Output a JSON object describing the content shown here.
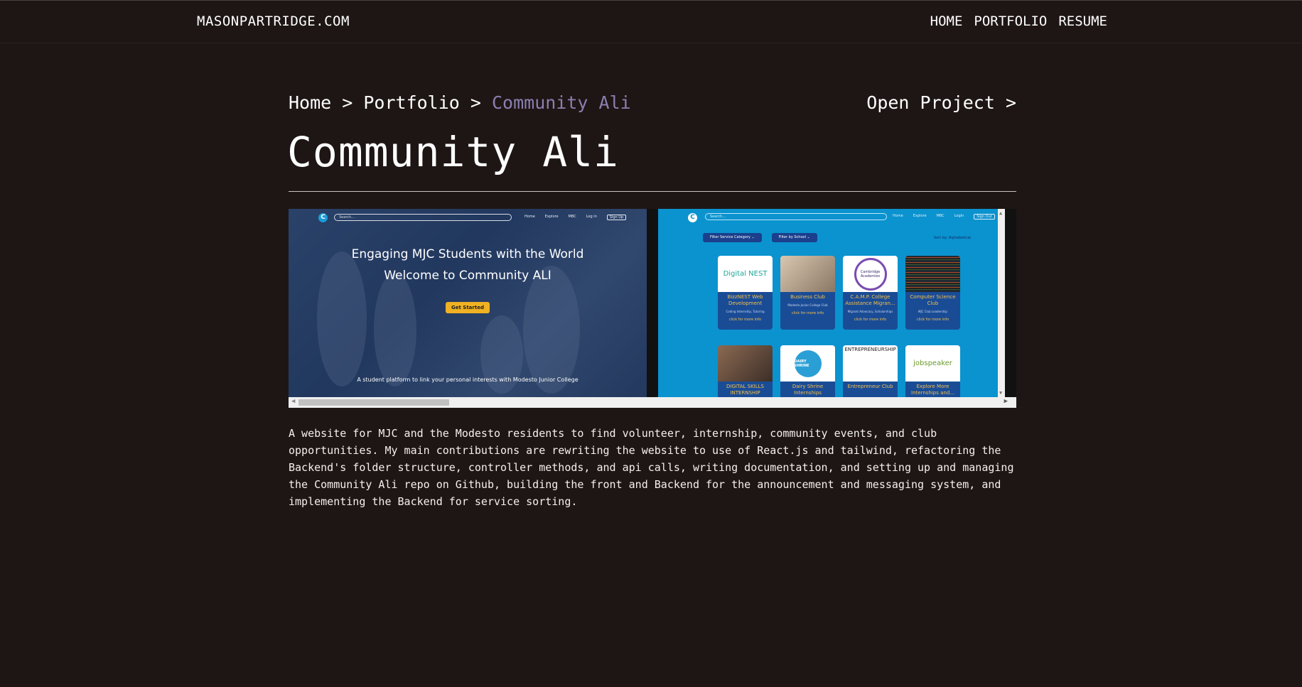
{
  "header": {
    "brand": "MASONPARTRIDGE.COM",
    "nav": [
      "HOME",
      "PORTFOLIO",
      "RESUME"
    ]
  },
  "breadcrumb": {
    "home": "Home",
    "portfolio": "Portfolio",
    "current": "Community Ali",
    "separator": " > "
  },
  "open_project": "Open Project >",
  "page_title": "Community Ali",
  "gallery": {
    "shot1": {
      "search_placeholder": "Search...",
      "links": [
        "Home",
        "Explore",
        "MBC",
        "Log in",
        "Sign Up"
      ],
      "headline1": "Engaging MJC Students with the World",
      "headline2": "Welcome to Community ALI",
      "cta": "Get Started",
      "tagline": "A student platform to link your personal interests with Modesto Junior College"
    },
    "shot2": {
      "search_placeholder": "Search...",
      "links": [
        "Home",
        "Explore",
        "MBC",
        "Login",
        "Sign Out"
      ],
      "filters": [
        "Filter Service Category ⌄",
        "Filter by School ⌄"
      ],
      "sort": "Sort by:  Alphabetical",
      "cards": [
        {
          "name": "BizzNEST Web Development",
          "sub": "Coding Internship, Tutoring",
          "more": "click for more info",
          "logo": "Digital NEST"
        },
        {
          "name": "Business Club",
          "sub": "Modesto Junior College Club",
          "more": "click for more info",
          "logo": ""
        },
        {
          "name": "C.A.M.P. College Assistance Migran...",
          "sub": "Migrant Advocacy, Scholarships",
          "more": "click for more info",
          "logo": "Cambridge Academies"
        },
        {
          "name": "Computer Science Club",
          "sub": "MJC Club Leadership",
          "more": "click for more info",
          "logo": ""
        },
        {
          "name": "DIGITAL SKILLS INTERNSHIP",
          "sub": "",
          "more": "",
          "logo": ""
        },
        {
          "name": "Dairy Shrine Internships",
          "sub": "",
          "more": "",
          "logo": "DAIRY SHRINE"
        },
        {
          "name": "Entrepreneur Club",
          "sub": "",
          "more": "",
          "logo": "ENTREPRENEURSHIP"
        },
        {
          "name": "Explore More Internships and...",
          "sub": "",
          "more": "",
          "logo": "jobspeaker"
        }
      ]
    }
  },
  "description": "A website for MJC and the Modesto residents to find volunteer, internship, community events, and club opportunities. My main contributions are rewriting the website to use of React.js and tailwind, refactoring the Backend's folder structure, controller methods, and api calls, writing documentation, and setting up and managing the Community Ali repo on Github, building the front and Backend for the announcement and messaging system, and implementing the Backend for service sorting.",
  "colors": {
    "background": "#1e1615",
    "text": "#f4f0ee",
    "breadcrumb_current": "#8b7fb0",
    "shot2_bg": "#0a93cf",
    "card_bg": "#1a4c96",
    "card_title": "#f6c04a",
    "cta": "#f0b122"
  }
}
